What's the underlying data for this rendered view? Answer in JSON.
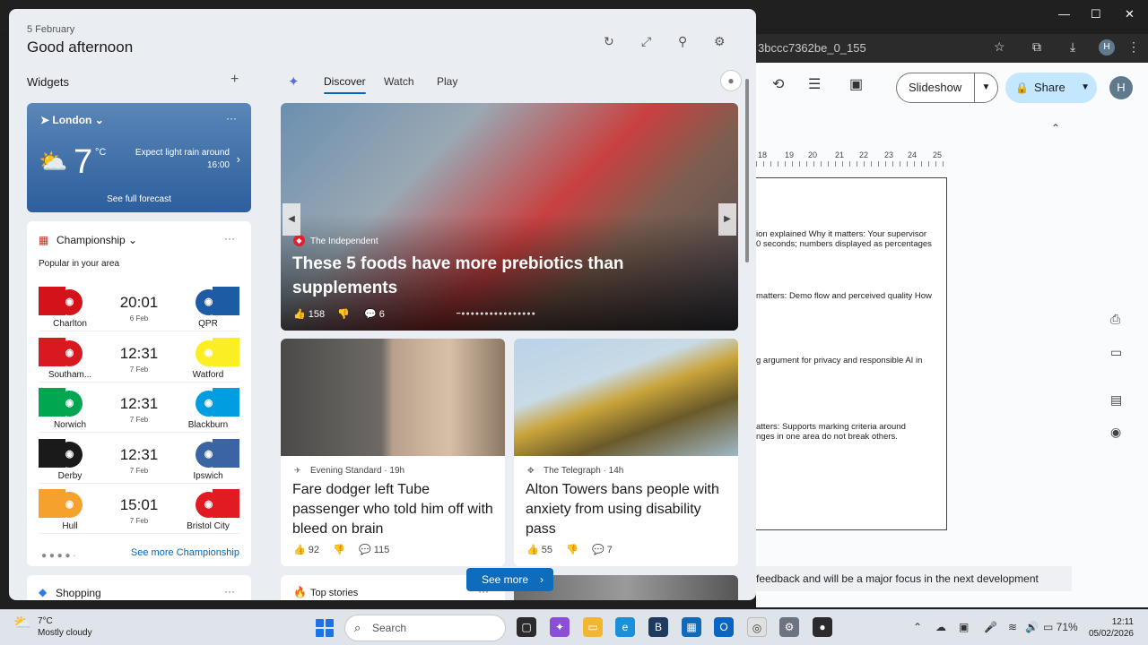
{
  "browser": {
    "url": "3bccc7362be_0_155",
    "window_controls": [
      "—",
      "☐",
      "✕"
    ],
    "icons": [
      "☆",
      "⧉",
      "⤓",
      "⋮"
    ],
    "avatar": "H"
  },
  "docs": {
    "slideshow_label": "Slideshow",
    "share_label": "Share",
    "avatar": "H",
    "ruler": [
      "18",
      "19",
      "20",
      "21",
      "22",
      "23",
      "24",
      "25"
    ],
    "lines": [
      "ion explained  Why it matters: Your supervisor",
      "0 seconds; numbers displayed as percentages",
      "matters: Demo flow and perceived quality  How",
      "g argument for privacy and responsible AI in",
      "atters: Supports marking criteria around",
      "nges in one area do not break others."
    ],
    "note": "feedback and will be a major focus in the next development"
  },
  "panel": {
    "date": "5 February",
    "greeting": "Good afternoon",
    "widgets_title": "Widgets",
    "weather": {
      "location": "London",
      "temp": "7",
      "unit": "°C",
      "forecast_line1": "Expect light rain around",
      "forecast_line2": "16:00",
      "full_forecast": "See full forecast"
    },
    "sports": {
      "title": "Championship",
      "subtitle": "Popular in your area",
      "see_more": "See more Championship",
      "matches": [
        {
          "home": "Charlton",
          "away": "QPR",
          "time": "20:01",
          "date": "6 Feb",
          "home_color": "#d4121a",
          "away_color": "#1d5ba4"
        },
        {
          "home": "Southam...",
          "away": "Watford",
          "time": "12:31",
          "date": "7 Feb",
          "home_color": "#d71920",
          "away_color": "#fbee23"
        },
        {
          "home": "Norwich",
          "away": "Blackburn",
          "time": "12:31",
          "date": "7 Feb",
          "home_color": "#00a650",
          "away_color": "#009ee0"
        },
        {
          "home": "Derby",
          "away": "Ipswich",
          "time": "12:31",
          "date": "7 Feb",
          "home_color": "#1a1a1a",
          "away_color": "#3a64a3"
        },
        {
          "home": "Hull",
          "away": "Bristol City",
          "time": "15:01",
          "date": "7 Feb",
          "home_color": "#f5a12d",
          "away_color": "#e21b23"
        }
      ]
    },
    "shopping_title": "Shopping",
    "tabs": [
      "Discover",
      "Watch",
      "Play"
    ],
    "hero": {
      "source": "The Independent",
      "headline": "These 5 foods have more prebiotics than supplements",
      "likes": "158",
      "comments": "6"
    },
    "cards": [
      {
        "source": "Evening Standard",
        "age": "19h",
        "headline": "Fare dodger left Tube passenger who told him off with bleed on brain",
        "likes": "92",
        "comments": "115"
      },
      {
        "source": "The Telegraph",
        "age": "14h",
        "headline": "Alton Towers bans people with anxiety from using disability pass",
        "likes": "55",
        "comments": "7"
      }
    ],
    "see_more": "See more",
    "top_stories": "Top stories"
  },
  "taskbar": {
    "weather_temp": "7°C",
    "weather_desc": "Mostly cloudy",
    "search_placeholder": "Search",
    "battery": "71%",
    "time": "12:11",
    "date": "05/02/2026"
  }
}
